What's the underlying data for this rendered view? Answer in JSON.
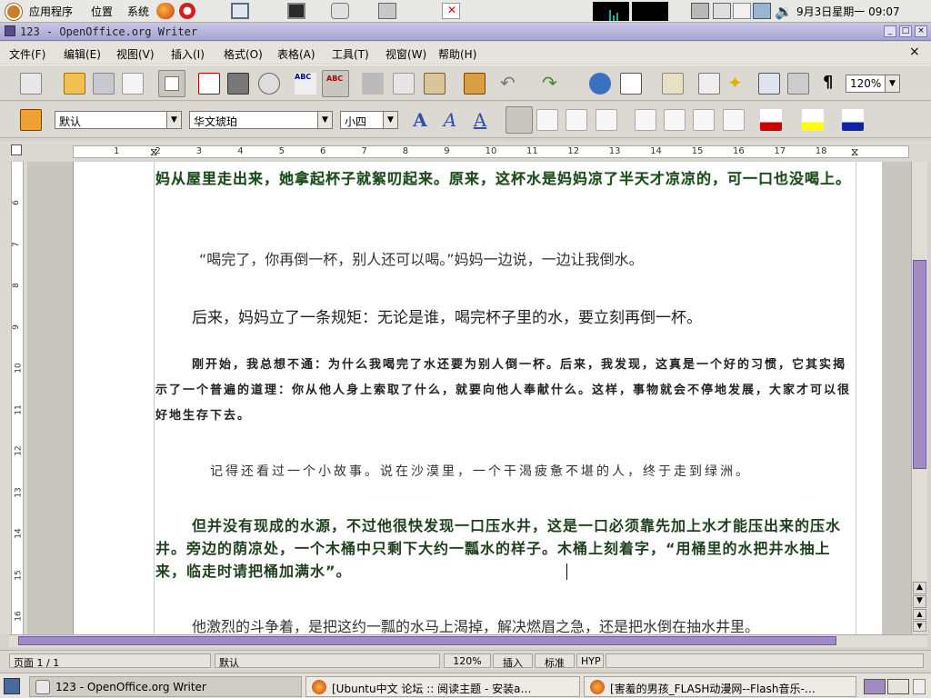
{
  "top_panel": {
    "menus": [
      "应用程序",
      "位置",
      "系统"
    ],
    "clock": "9月3日星期一 09:07"
  },
  "window": {
    "title": "123 - OpenOffice.org Writer",
    "controls": [
      "_",
      "□",
      "×"
    ]
  },
  "menubar": {
    "items": [
      "文件(F)",
      "编辑(E)",
      "视图(V)",
      "插入(I)",
      "格式(O)",
      "表格(A)",
      "工具(T)",
      "视窗(W)",
      "帮助(H)"
    ],
    "close": "×"
  },
  "toolbar": {
    "zoom": "120%",
    "pilcrow": "¶"
  },
  "format_bar": {
    "style": "默认",
    "font": "华文琥珀",
    "size": "小四"
  },
  "ruler": {
    "ticks": [
      "1",
      "2",
      "3",
      "4",
      "5",
      "6",
      "7",
      "8",
      "9",
      "10",
      "11",
      "12",
      "13",
      "14",
      "15",
      "16",
      "17",
      "18"
    ]
  },
  "vruler": {
    "ticks": [
      "6",
      "7",
      "8",
      "9",
      "10",
      "11",
      "12",
      "13",
      "14",
      "15",
      "16"
    ]
  },
  "document": {
    "p1": "妈从屋里走出来，她拿起杯子就絮叨起来。原来，这杯水是妈妈凉了半天才凉凉的，可一口也没喝上。",
    "p2": "“喝完了，你再倒一杯，别人还可以喝。”妈妈一边说，一边让我倒水。",
    "p3": "后来，妈妈立了一条规矩：无论是谁，喝完杯子里的水，要立刻再倒一杯。",
    "p4": "刚开始，我总想不通：为什么我喝完了水还要为别人倒一杯。后来，我发现，这真是一个好的习惯，它其实揭示了一个普遍的道理：你从他人身上索取了什么，就要向他人奉献什么。这样，事物就会不停地发展，大家才可以很好地生存下去。",
    "p5": "记得还看过一个小故事。说在沙漠里，一个干渴疲惫不堪的人，终于走到绿洲。",
    "p6": "但并没有现成的水源，不过他很快发现一口压水井，这是一口必须靠先加上水才能压出来的压水井。旁边的荫凉处，一个木桶中只剩下大约一瓢水的样子。木桶上刻着字，“用桶里的水把井水抽上来，临走时请把桶加满水”。",
    "p7": "他激烈的斗争着，是把这约一瓢的水马上渴掉，解决燃眉之急，还是把水倒在抽水井里。"
  },
  "statusbar": {
    "page": "页面 1 / 1",
    "style": "默认",
    "zoom": "120%",
    "insert": "插入",
    "standard": "标准",
    "hyp": "HYP"
  },
  "taskbar": {
    "tasks": [
      "123 - OpenOffice.org Writer",
      "[Ubuntu中文 论坛 :: 阅读主题 - 安装a…",
      "[害羞的男孩_FLASH动漫网--Flash音乐-…"
    ]
  },
  "colors": {
    "titlebar": "#a7a4d3",
    "heading_green": "#1e4a1e",
    "scroll_thumb": "#a08cc0"
  }
}
